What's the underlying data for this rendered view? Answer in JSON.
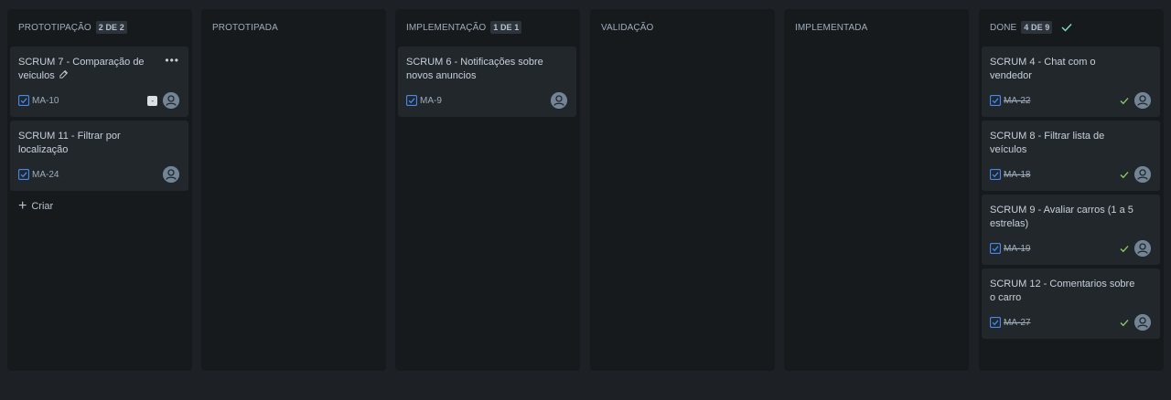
{
  "columns": [
    {
      "title": "PROTOTIPAÇÃO",
      "count": "2 DE 2",
      "cards": [
        {
          "title": "SCRUM 7 - Comparação de veiculos",
          "key": "MA-10",
          "estimate": "-"
        },
        {
          "title": "SCRUM 11 - Filtrar por localização",
          "key": "MA-24"
        }
      ],
      "create_label": "Criar"
    },
    {
      "title": "PROTOTIPADA"
    },
    {
      "title": "IMPLEMENTAÇÃO",
      "count": "1 DE 1",
      "cards": [
        {
          "title": "SCRUM 6 - Notificações sobre novos anuncios",
          "key": "MA-9"
        }
      ]
    },
    {
      "title": "VALIDAÇÃO"
    },
    {
      "title": "IMPLEMENTADA"
    },
    {
      "title": "DONE",
      "count": "4 DE 9",
      "cards": [
        {
          "title": "SCRUM 4 - Chat com o vendedor",
          "key": "MA-22"
        },
        {
          "title": "SCRUM 8 - Filtrar lista de veículos",
          "key": "MA-18"
        },
        {
          "title": "SCRUM 9 - Avaliar carros (1 a 5 estrelas)",
          "key": "MA-19"
        },
        {
          "title": "SCRUM 12 - Comentarios sobre o carro",
          "key": "MA-27"
        }
      ]
    }
  ],
  "icons": {
    "task": "checkbox-task-icon",
    "avatar": "user-avatar-icon",
    "edit": "pencil-edit-icon",
    "more": "more-actions-icon",
    "done_check": "checkmark-icon",
    "create": "plus-icon"
  },
  "colors": {
    "background": "#1d2125",
    "column": "#161a1d",
    "card": "#22272b",
    "task_icon": "#4688ec",
    "done_check": "#7ee2b8",
    "resolved_check": "#8fd16a"
  }
}
